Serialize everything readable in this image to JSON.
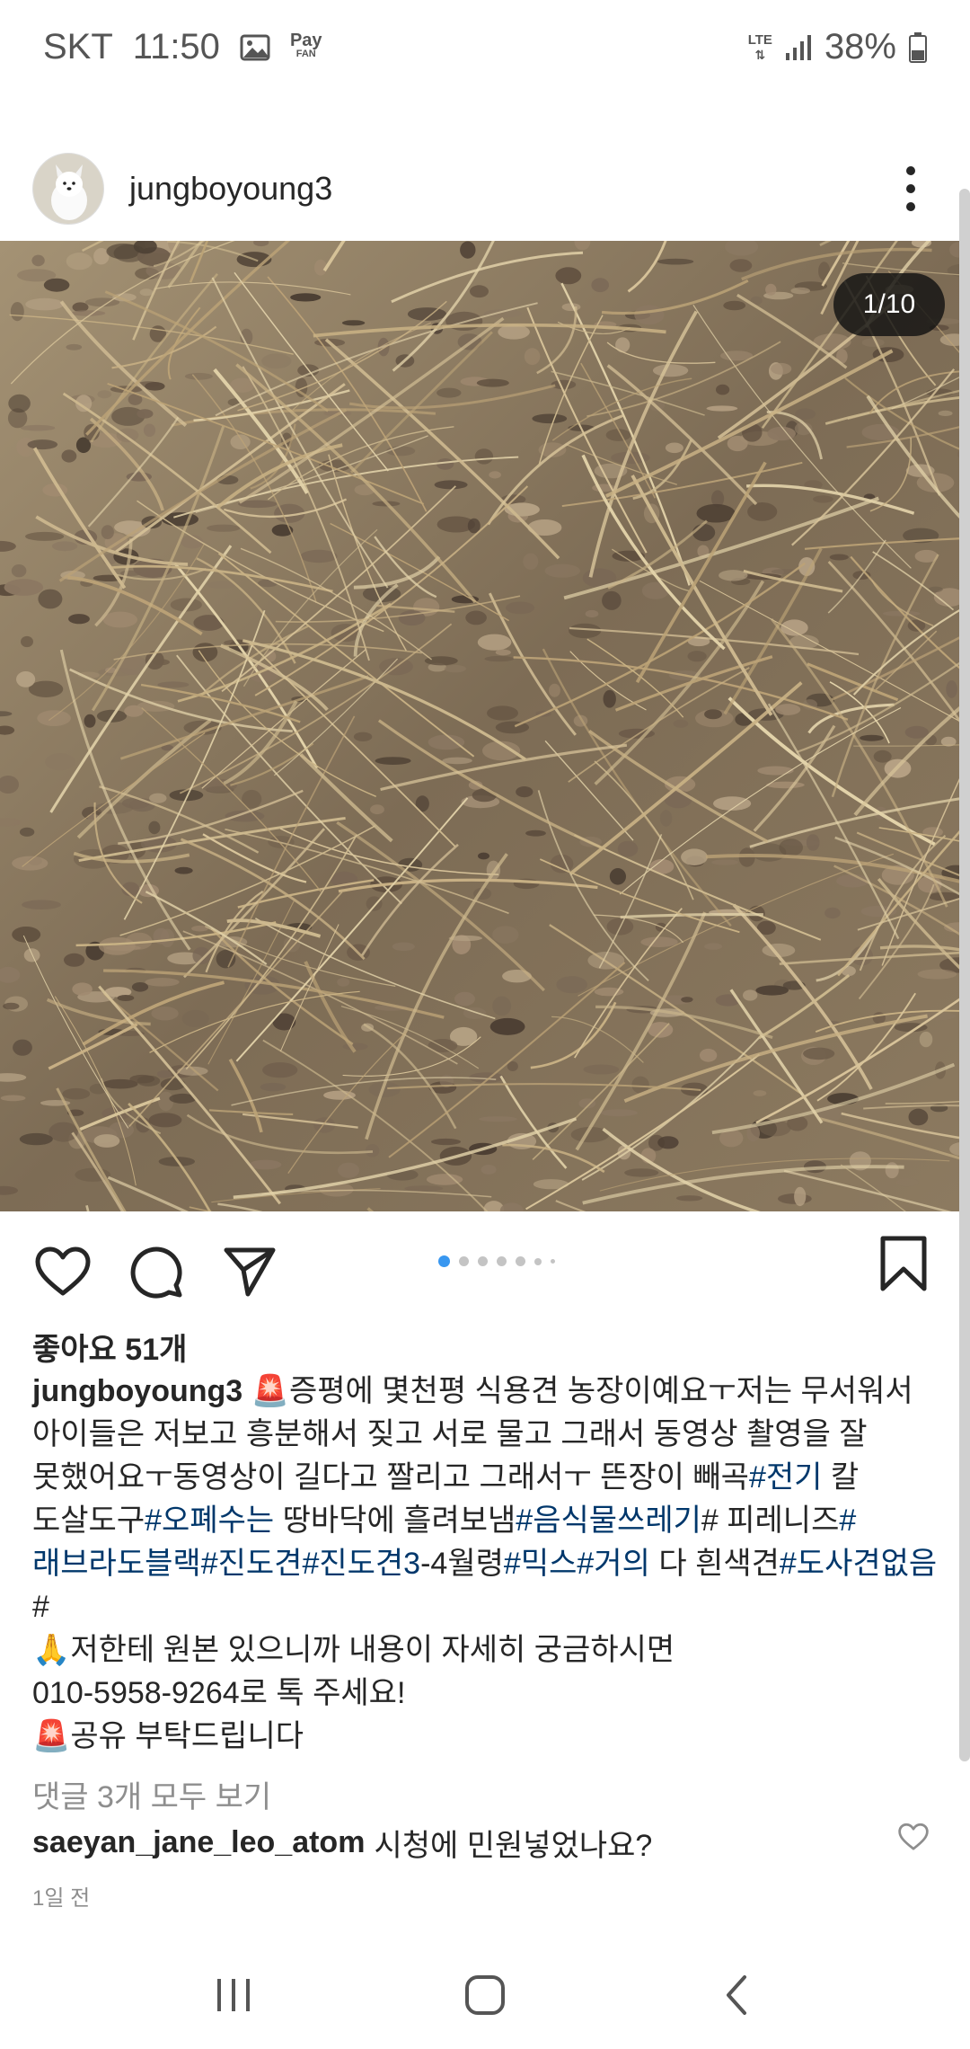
{
  "status_bar": {
    "carrier": "SKT",
    "time": "11:50",
    "pay_label_top": "Pay",
    "pay_label_bottom": "FAN",
    "network_top": "LTE",
    "battery": "38%",
    "icons": [
      "gallery-icon",
      "samsung-pay-icon",
      "lte-icon",
      "signal-icon",
      "battery-icon"
    ]
  },
  "post": {
    "username": "jungboyoung3",
    "media_counter": "1/10",
    "carousel_total": 7,
    "carousel_active": 0,
    "likes": "좋아요 51개",
    "caption": {
      "user": "jungboyoung3",
      "line1": "🚨증평에 몇천평 식용견 농장이예요ㅜ저는 무서워서 아이들은 저보고 흥분해서 짖고 서로 물고 그래서 동영상 촬영을 잘 못했어요ㅜ동영상이 길다고 짤리고 그래서ㅜ 뜬장이 빼곡",
      "tag1": "#전기",
      "text2": " 칼 도살도구",
      "tag2": "#오폐수는",
      "text3": " 땅바닥에 흘려보냄",
      "tag3": "#음식물쓰레기",
      "text4": "# 피레니즈",
      "tag4": "#래브라도블랙",
      "tag5": "#진도견",
      "tag6": "#진도견3",
      "text5": "-4월령",
      "tag7": "#믹스",
      "tag8": "#거의",
      "text6": " 다 흰색견",
      "tag9": "#도사견없음",
      "text7": "#",
      "line2": "🙏저한테 원본 있으니까 내용이 자세히 궁금하시면",
      "line3": "010-5958-9264로 톡 주세요!",
      "line4": "🚨공유 부탁드립니다"
    },
    "view_comments": "댓글 3개 모두 보기",
    "comment": {
      "user": "saeyan_jane_leo_atom",
      "text": "시청에 민원넣었나요?"
    },
    "time_ago": "1일 전"
  },
  "colors": {
    "text": "#262626",
    "secondary": "#8e8e8e",
    "hashtag": "#00376b",
    "accent_dot": "#3897f0"
  }
}
